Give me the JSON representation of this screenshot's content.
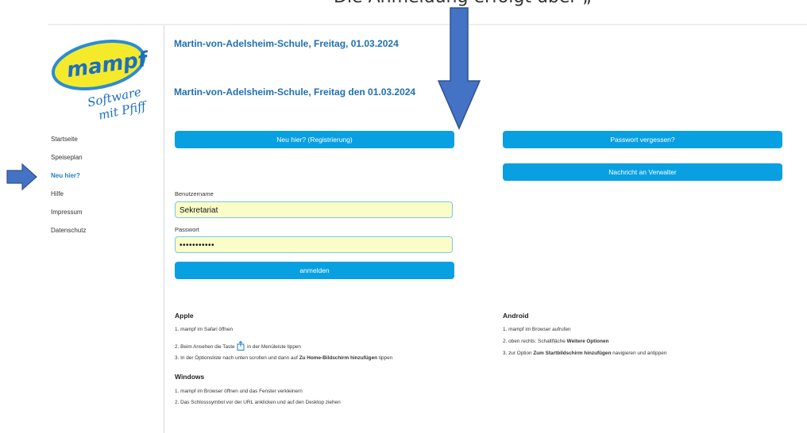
{
  "fragment_top": "Die Anmeldung erfolgt über „",
  "logo": {
    "brand": "mampf",
    "tagline_1": "Software",
    "tagline_2": "mit Pfiff"
  },
  "nav": [
    {
      "label": "Startseite",
      "active": false
    },
    {
      "label": "Speiseplan",
      "active": false
    },
    {
      "label": "Neu hier?",
      "active": true
    },
    {
      "label": "Hilfe",
      "active": false
    },
    {
      "label": "Impressum",
      "active": false
    },
    {
      "label": "Datenschutz",
      "active": false
    }
  ],
  "title_1": "Martin-von-Adelsheim-Schule, Freitag, 01.03.2024",
  "title_2": "Martin-von-Adelsheim-Schule, Freitag den 01.03.2024",
  "buttons": {
    "register": "Neu hier? (Registrierung)",
    "forgot": "Passwort vergessen?",
    "message": "Nachricht an Verwalter",
    "login": "anmelden"
  },
  "form": {
    "username_label": "Benutzername",
    "username_value": "Sekretariat",
    "password_label": "Passwort",
    "password_value": "•••••••••••"
  },
  "apple": {
    "heading": "Apple",
    "line1": "1. mampf im Safari öffnen",
    "line2_pre": "2. Beim Ansehen die Taste",
    "line2_post": "in der Menüleiste tippen",
    "line3_pre": "3. In der Optionsliste nach unten scrollen und dann auf ",
    "line3_bold": "Zu Home-Bildschirm hinzufügen",
    "line3_post": " tippen"
  },
  "windows": {
    "heading": "Windows",
    "line1": "1. mampf im Browser öffnen und das Fenster verkleinern",
    "line2": "2. Das Schlosssymbol vor der URL anklicken und auf den Desktop ziehen"
  },
  "android": {
    "heading": "Android",
    "line1": "1. mampf im Browser aufrufen",
    "line2_pre": "2. oben rechts: Schaltfläche ",
    "line2_bold": "Weitere Optionen",
    "line3_pre": "3. zur Option ",
    "line3_bold": "Zum Startbildschirm hinzufügen",
    "line3_post": " navigieren und antippen"
  },
  "colors": {
    "accent": "#09a0e2",
    "title": "#1f6fb3",
    "arrow": "#4472c4",
    "field_bg": "#fafdc8"
  }
}
